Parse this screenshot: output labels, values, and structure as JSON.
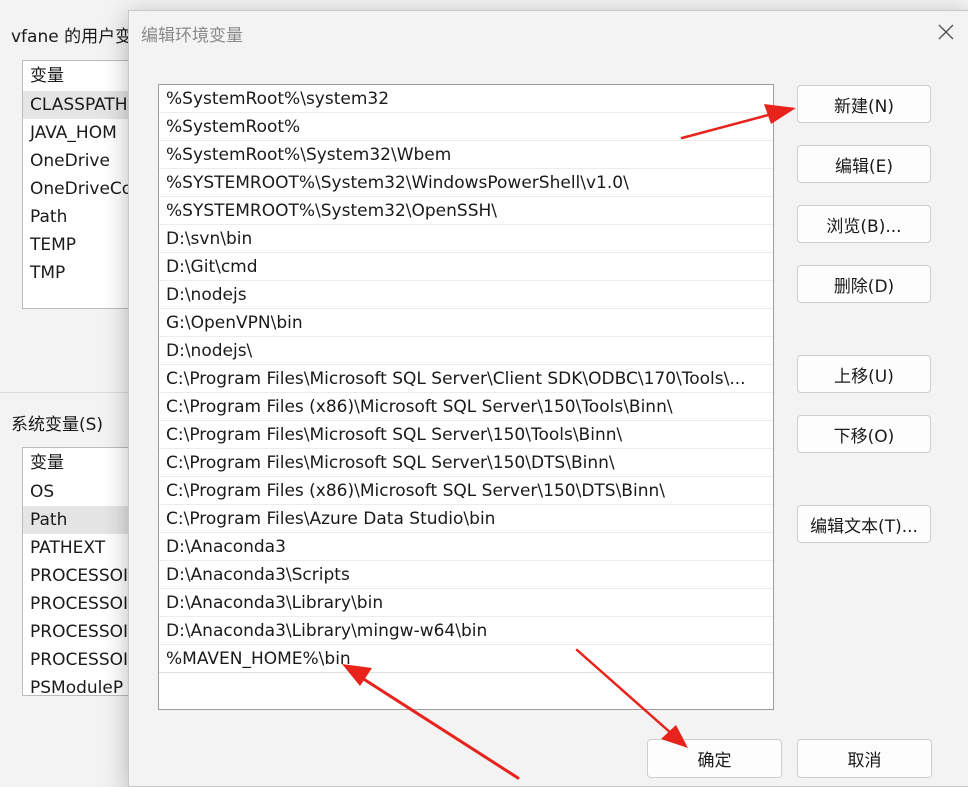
{
  "background_window": {
    "title": "vfane 的用户变",
    "user_vars": {
      "header": "变量",
      "items": [
        "CLASSPATH",
        "JAVA_HOM",
        "OneDrive",
        "OneDriveCo",
        "Path",
        "TEMP",
        "TMP"
      ]
    },
    "system_section_label": "系统变量(S)",
    "system_vars": {
      "header": "变量",
      "items": [
        "OS",
        "Path",
        "PATHEXT",
        "PROCESSOI",
        "PROCESSOI",
        "PROCESSOI",
        "PROCESSOI",
        "PSModuleP"
      ]
    }
  },
  "dialog": {
    "title": "编辑环境变量",
    "paths": [
      "%SystemRoot%\\system32",
      "%SystemRoot%",
      "%SystemRoot%\\System32\\Wbem",
      "%SYSTEMROOT%\\System32\\WindowsPowerShell\\v1.0\\",
      "%SYSTEMROOT%\\System32\\OpenSSH\\",
      "D:\\svn\\bin",
      "D:\\Git\\cmd",
      "D:\\nodejs",
      "G:\\OpenVPN\\bin",
      "D:\\nodejs\\",
      "C:\\Program Files\\Microsoft SQL Server\\Client SDK\\ODBC\\170\\Tools\\...",
      "C:\\Program Files (x86)\\Microsoft SQL Server\\150\\Tools\\Binn\\",
      "C:\\Program Files\\Microsoft SQL Server\\150\\Tools\\Binn\\",
      "C:\\Program Files\\Microsoft SQL Server\\150\\DTS\\Binn\\",
      "C:\\Program Files (x86)\\Microsoft SQL Server\\150\\DTS\\Binn\\",
      "C:\\Program Files\\Azure Data Studio\\bin",
      "D:\\Anaconda3",
      "D:\\Anaconda3\\Scripts",
      "D:\\Anaconda3\\Library\\bin",
      "D:\\Anaconda3\\Library\\mingw-w64\\bin",
      "%MAVEN_HOME%\\bin"
    ],
    "buttons": {
      "new": "新建(N)",
      "edit": "编辑(E)",
      "browse": "浏览(B)...",
      "delete": "删除(D)",
      "move_up": "上移(U)",
      "move_down": "下移(O)",
      "edit_text": "编辑文本(T)...",
      "ok": "确定",
      "cancel": "取消"
    }
  },
  "annotation_color": "#e8231c"
}
